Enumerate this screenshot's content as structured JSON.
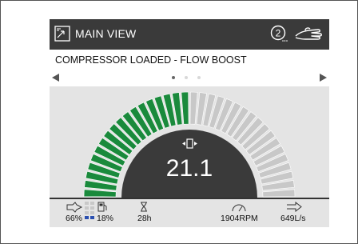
{
  "header": {
    "title": "MAIN VIEW",
    "badge": "2",
    "icons": [
      "main-view-icon",
      "number-circle-icon",
      "hand-service-icon"
    ]
  },
  "status": {
    "message": "COMPRESSOR LOADED - FLOW BOOST"
  },
  "pager": {
    "page_count": 3,
    "active_page": 1
  },
  "gauge": {
    "value": "21.1",
    "segments_total": 36,
    "segments_active": 18,
    "active_color": "#1a8a3c",
    "inactive_color": "#c8c8c8",
    "center_icon": "pressure-indicator-icon"
  },
  "bottom": {
    "load_percent": "66%",
    "fuel_percent": "18%",
    "hours": "28h",
    "rpm": "1904RPM",
    "flow": "649L/s"
  }
}
